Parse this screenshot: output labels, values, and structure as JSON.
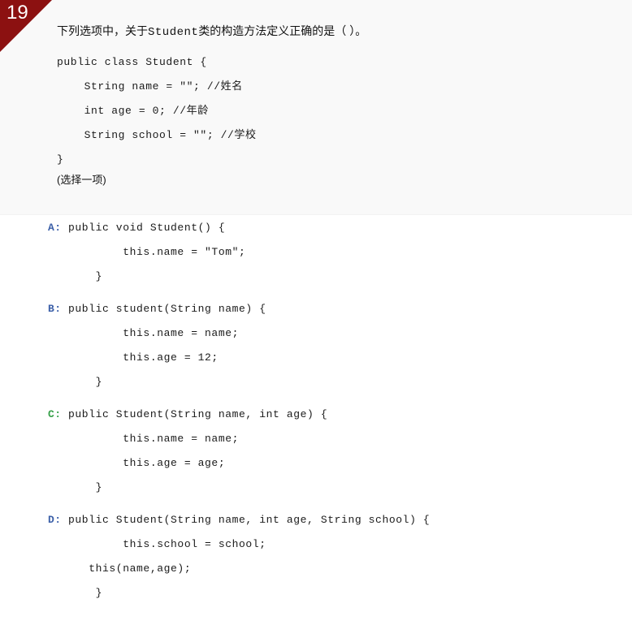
{
  "ribbon": {
    "number": "19",
    "color": "#8c1111",
    "text_color": "#ffffff"
  },
  "question": {
    "prompt_prefix": "下列选项中，关于",
    "prompt_mono": "Student",
    "prompt_suffix": "类的构造方法定义正确的是（  ）。",
    "prompt_full": "下列选项中，关于Student类的构造方法定义正确的是（  ）。",
    "code": "public class Student {\n    String name = \"\"; //姓名\n    int age = 0; //年龄\n    String school = \"\"; //学校\n}",
    "select_note": "(选择一项)",
    "panel_background": "#f9f9f9"
  },
  "options": [
    {
      "letter": "A:",
      "letter_color": "#3b5fa8",
      "is_correct": false,
      "code": "public void Student() {\n        this.name = \"Tom\";\n    }"
    },
    {
      "letter": "B:",
      "letter_color": "#3b5fa8",
      "is_correct": false,
      "code": "public student(String name) {\n        this.name = name;\n        this.age = 12;\n    }"
    },
    {
      "letter": "C:",
      "letter_color": "#37a04a",
      "is_correct": true,
      "code": "public Student(String name, int age) {\n        this.name = name;\n        this.age = age;\n    }"
    },
    {
      "letter": "D:",
      "letter_color": "#3b5fa8",
      "is_correct": false,
      "code": "public Student(String name, int age, String school) {\n        this.school = school;\n   this(name,age);\n    }"
    }
  ]
}
